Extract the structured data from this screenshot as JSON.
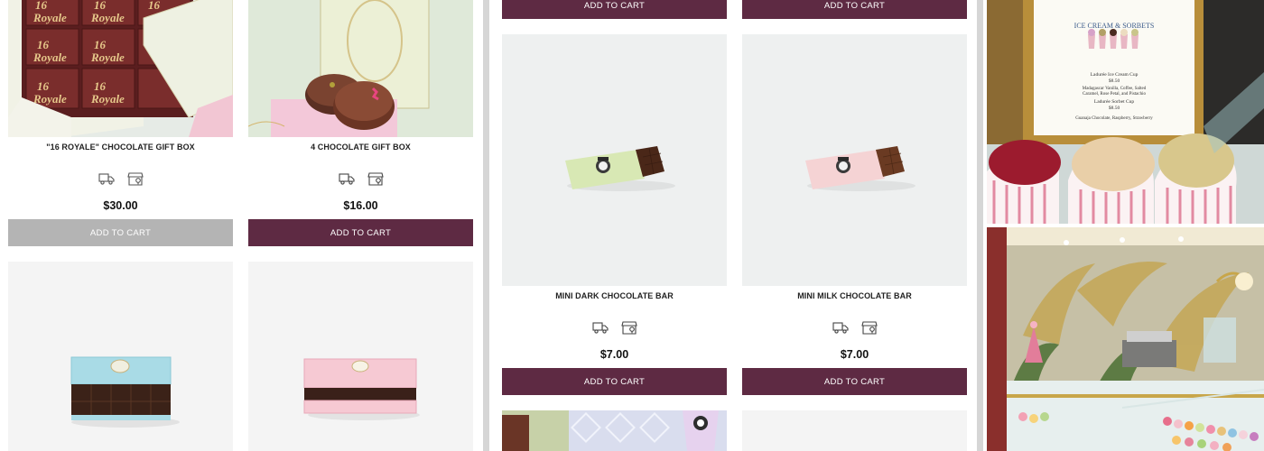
{
  "colors": {
    "brand_plum": "#5e2a43",
    "disabled_gray": "#b4b4b4",
    "page_bg": "#ffffff",
    "divider_gray": "#d6d6d6"
  },
  "icons": {
    "delivery": "delivery-truck-icon",
    "store": "store-pickup-icon"
  },
  "left_panel": {
    "products": [
      {
        "name": "\"16 ROYALE\" CHOCOLATE GIFT BOX",
        "price": "$30.00",
        "cart_label": "ADD TO CART",
        "cart_state": "disabled",
        "image": {
          "kind": "box",
          "print": "16 Royale"
        }
      },
      {
        "name": "4 CHOCOLATE GIFT BOX",
        "price": "$16.00",
        "cart_label": "ADD TO CART",
        "cart_state": "active",
        "image": {
          "kind": "chocolate-discs",
          "print": ""
        }
      },
      {
        "name": "",
        "price": "",
        "image": {
          "kind": "blue-box",
          "print": ""
        }
      },
      {
        "name": "",
        "price": "",
        "image": {
          "kind": "pink-box",
          "print": ""
        }
      }
    ]
  },
  "middle_panel": {
    "top_buttons": [
      "ADD TO CART",
      "ADD TO CART"
    ],
    "products": [
      {
        "name": "MINI DARK CHOCOLATE BAR",
        "price": "$7.00",
        "cart_label": "ADD TO CART",
        "cart_state": "active",
        "image": {
          "kind": "bar-green"
        }
      },
      {
        "name": "MINI MILK CHOCOLATE BAR",
        "price": "$7.00",
        "cart_label": "ADD TO CART",
        "cart_state": "active",
        "image": {
          "kind": "bar-pink"
        }
      }
    ]
  },
  "right_panel": {
    "photos": [
      {
        "kind": "ice-cream-display",
        "sign_title": "ICE CREAM & SORBETS",
        "sign_lines": [
          "Ladurée Ice Cream Cup",
          "$8.50",
          "Madagascar Vanilla, Coffee, Salted",
          "Caramel, Rose Petal, and Pistachio",
          "Ladurée Sorbet Cup",
          "$8.50",
          "Guanaja Chocolate, Raspberry, Strawberry"
        ]
      },
      {
        "kind": "boutique-interior"
      }
    ]
  }
}
